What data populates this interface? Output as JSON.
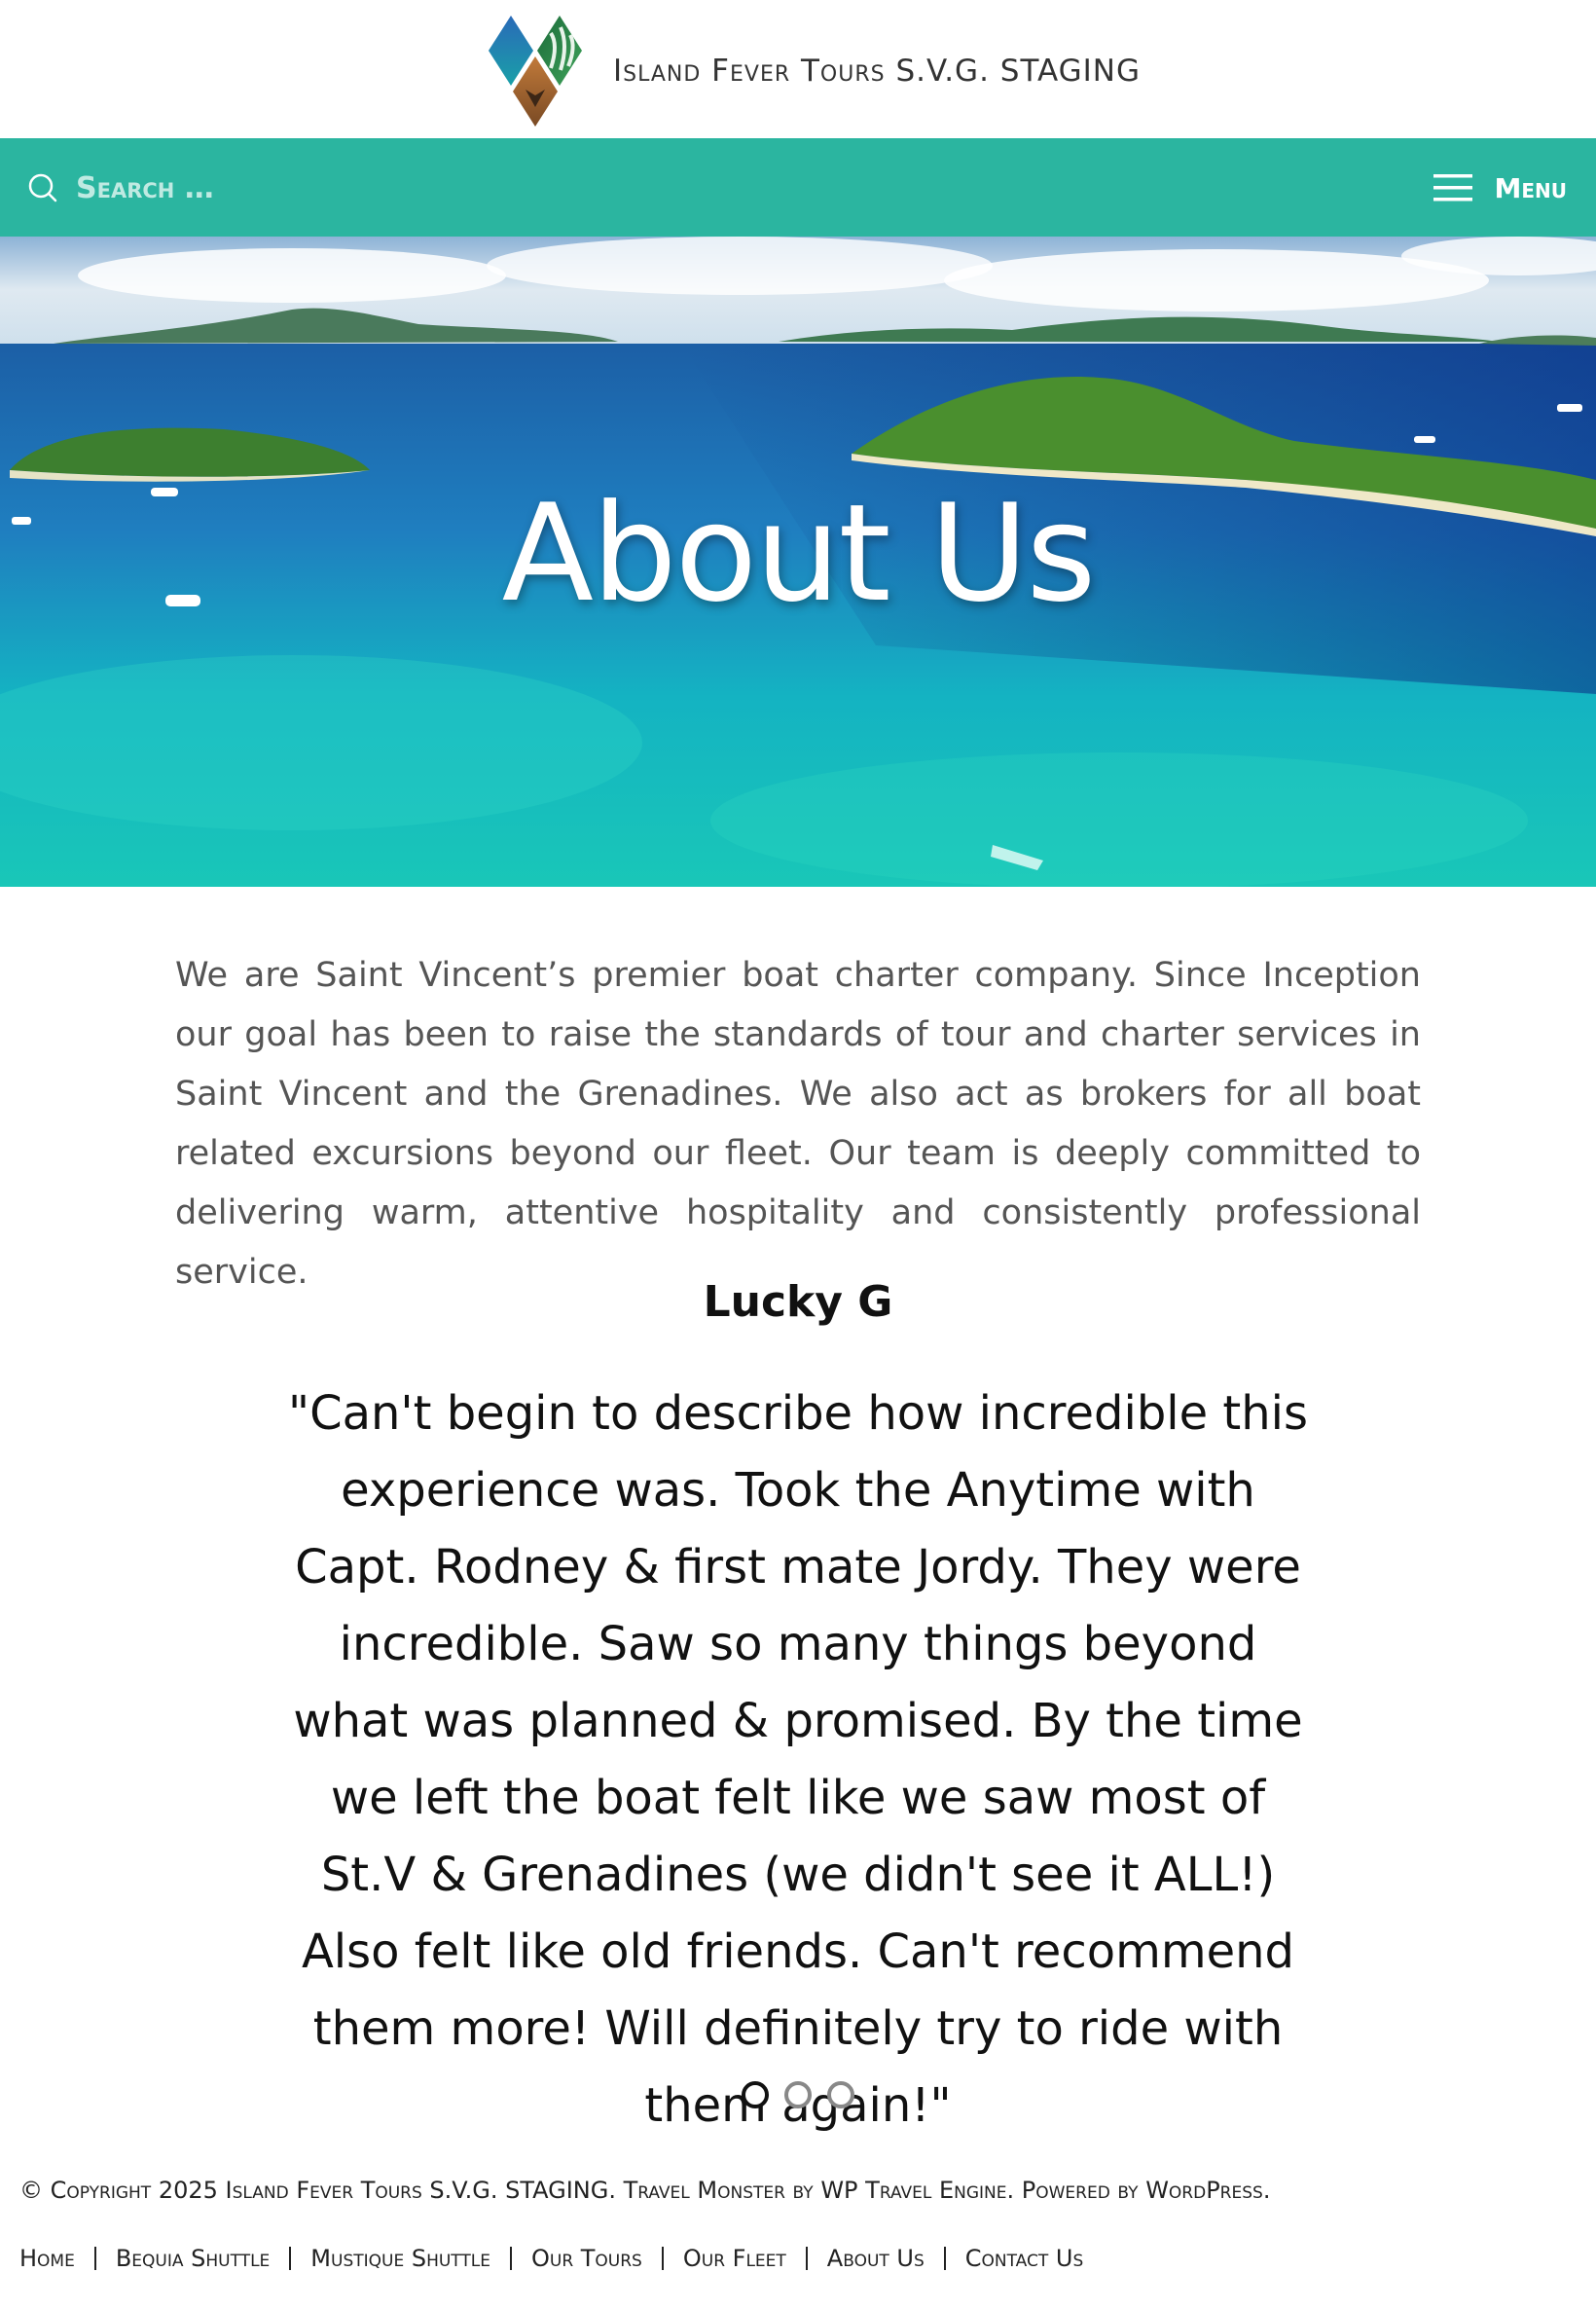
{
  "site": {
    "title": "Island Fever Tours S.V.G. STAGING"
  },
  "navbar": {
    "search_placeholder": "Search …",
    "menu_label": "Menu",
    "color": "#2bb5a0"
  },
  "hero": {
    "title": "About Us"
  },
  "intro": {
    "text": "We are Saint Vincent’s premier boat charter company. Since Inception our goal has been to raise the standards of tour and charter services in Saint Vincent and the Grenadines.  We also act as brokers for all boat related excursions beyond our fleet. Our team is deeply committed to delivering warm, attentive hospitality and consistently professional service."
  },
  "testimonial": {
    "name": "Lucky G",
    "quote": "\"Can't begin to describe how incredible this experience was. Took the Anytime with Capt. Rodney & first mate Jordy. They were incredible. Saw so many things beyond what was planned & promised. By the time we left the boat felt like we saw most of St.V & Grenadines (we didn't see it ALL!) Also felt like old friends. Can't recommend them more! Will definitely try to ride with them again!\"",
    "slides": 3,
    "active_slide": 1
  },
  "footer": {
    "copyright_prefix": "© Copyright 2025",
    "site_link": "Island Fever Tours S.V.G. STAGING",
    "theme_text": ". Travel Monster by",
    "theme_author": "WP Travel Engine",
    "powered_text": ". Powered by",
    "powered_link": "WordPress",
    "end": ".",
    "nav": [
      {
        "label": "Home"
      },
      {
        "label": "Bequia Shuttle"
      },
      {
        "label": "Mustique Shuttle"
      },
      {
        "label": "Our Tours"
      },
      {
        "label": "Our Fleet"
      },
      {
        "label": "About Us"
      },
      {
        "label": "Contact Us"
      }
    ]
  },
  "icons": {
    "search": "search-icon",
    "menu": "hamburger-icon",
    "logo": "diamond-logo"
  }
}
